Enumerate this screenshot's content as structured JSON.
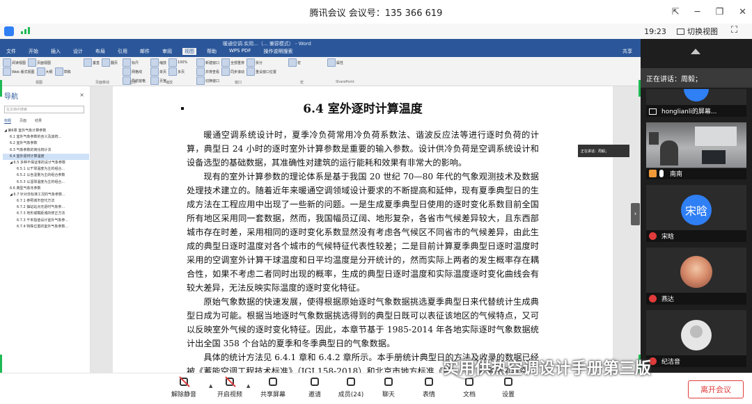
{
  "window": {
    "title": "腾讯会议 会议号：135 366 619",
    "controls": {
      "pin": "⇱",
      "minimize": "─",
      "maximize": "❐",
      "close": "✕"
    }
  },
  "infobar": {
    "time": "19:23",
    "switch_view": "切换视图",
    "fullscreen": "⛶",
    "colors": {
      "shield": "#2f7ff5",
      "signal": "#1db954"
    }
  },
  "word": {
    "doc_title": "暖通空调.实用...（... 兼容模式） - Word",
    "tabs": [
      "文件",
      "开始",
      "插入",
      "设计",
      "布局",
      "引用",
      "邮件",
      "审阅",
      "视图",
      "帮助",
      "WPS PDF",
      "操作说明搜索"
    ],
    "active_tab": "视图",
    "user": "共享",
    "ribbon_groups": [
      {
        "name": "视图",
        "items": [
          "阅读视图",
          "页面视图",
          "Web 版式视图",
          "大纲",
          "草稿"
        ]
      },
      {
        "name": "页面移动",
        "items": [
          "垂直",
          "翻页"
        ]
      },
      {
        "name": "显示",
        "items": [
          "标尺",
          "网格线",
          "导航窗格"
        ]
      },
      {
        "name": "缩放",
        "items": [
          "缩放",
          "100%",
          "单页",
          "多页",
          "页宽"
        ]
      },
      {
        "name": "窗口",
        "items": [
          "新建窗口",
          "全部重排",
          "拆分",
          "并排查看",
          "同步滚动",
          "重设窗口位置",
          "切换窗口"
        ]
      },
      {
        "name": "宏",
        "items": [
          "宏"
        ]
      },
      {
        "name": "SharePoint",
        "items": [
          "属性"
        ]
      }
    ],
    "nav": {
      "title": "导航",
      "close": "×",
      "search_placeholder": "在文档中搜索",
      "tabs": [
        "标题",
        "页面",
        "结果"
      ],
      "outline": [
        "◢ 第6章 室外气象计算参数",
        "6.1 室外气象参数的含义及其统...",
        "6.2 室外气象参数",
        "6.3 气象参数的简化统计法",
        "6.4 室外逐时计算温度",
        "◢ 6.5 多种不保证率的设计气象参数",
        "6.5.1 以干球温度为主的组合...",
        "6.5.2 以含湿量为主的组合参数",
        "6.5.3 以湿球温度为主的组合...",
        "6.6 典型气象年参数",
        "◢ 6.7 针对非标准工况的气象参数...",
        "6.7.1 参照城市替代方法",
        "6.7.2 抽站站点无逐时气象参...",
        "6.7.3 地形或截距城的修正方法",
        "6.7.3 干未指值设计室外气象参...",
        "6.7.4 特殊位置的室外气象参数..."
      ],
      "selected_index": 4
    },
    "document": {
      "heading": "6.4  室外逐时计算温度",
      "paragraphs": [
        "暖通空调系统设计时，夏季冷负荷常用冷负荷系数法、谐波反应法等进行逐时负荷的计算，典型日 24 小时的逐时室外计算参数是重要的输入参数。设计供冷负荷是空调系统设计和设备选型的基础数据，其准确性对建筑的运行能耗和效果有非常大的影响。",
        "现有的室外计算参数的理论体系是基于我国 20 世纪 70—80 年代的气象观测技术及数据处理技术建立的。随着近年来暖通空调领域设计要求的不断提高和延伸，现有夏季典型日的生成方法在工程应用中出现了一些新的问题。一是生成夏季典型日使用的逐时变化系数目前全国所有地区采用同一套数据，然而，我国幅员辽阔、地形复杂，各省市气候差异较大，且东西部城市存在时差，采用相同的逐时变化系数显然没有考虑各气候区不同省市的气候差异，由此生成的典型日逐时温度对各个城市的气候特征代表性较差；二是目前计算夏季典型日逐时温度时采用的空调室外计算干球温度和日平均温度是分开统计的，然而实际上两者的发生概率存在耦合性，如果不考虑二者同时出现的概率，生成的典型日逐时温度和实际温度逐时变化曲线会有较大差异，无法反映实际温度的逐时变化特征。",
        "原始气象数据的快速发展，使得根据原始逐时气象数据挑选夏季典型日来代替统计生成典型日成为可能。根据当地逐时气象数据挑选得到的典型日既可以表征该地区的气候特点，又可以反映室外气候的逐时变化特征。因此，本章节基于 1985-2014 年各地实际逐时气象数据统计出全国 358 个台站的夏季和冬季典型日的气象数据。",
        "具体的统计方法见 6.4.1 章和 6.4.2 章所示。本手册统计典型日的方法及收录的数据已经被《蓄能空调工程技术标准》（JGJ 158-2018）和北京市地方标准《民用建筑供暖通风与空"
      ],
      "speaking_overlay": "正在讲话：周毅；"
    }
  },
  "side_panel": {
    "speaking": "正在讲话：周毅；",
    "participants": [
      {
        "name": "honglianli的屏幕...",
        "type": "screen",
        "avatar_text": ""
      },
      {
        "name": "南南",
        "type": "camera",
        "avatar_text": ""
      },
      {
        "name": "宋晗",
        "type": "avatar",
        "avatar_text": "宋晗"
      },
      {
        "name": "燕达",
        "type": "photo",
        "avatar_text": ""
      },
      {
        "name": "纪洁音",
        "type": "gray",
        "avatar_text": ""
      }
    ],
    "accent": "#2f7ff5"
  },
  "toolbar": {
    "items": [
      {
        "label": "解除静音",
        "icon": "muted-mic-icon"
      },
      {
        "label": "开启视频",
        "icon": "video-off-icon"
      },
      {
        "label": "共享屏幕",
        "icon": "share-screen-icon"
      },
      {
        "label": "邀请",
        "icon": "invite-icon"
      },
      {
        "label": "成员(24)",
        "icon": "members-icon"
      },
      {
        "label": "聊天",
        "icon": "chat-icon"
      },
      {
        "label": "表情",
        "icon": "emoji-icon"
      },
      {
        "label": "文档",
        "icon": "document-icon"
      },
      {
        "label": "设置",
        "icon": "settings-icon"
      }
    ],
    "leave": "离开会议",
    "leave_color": "#e13b3b"
  },
  "watermark": "实用供热空调设计手册第三版"
}
